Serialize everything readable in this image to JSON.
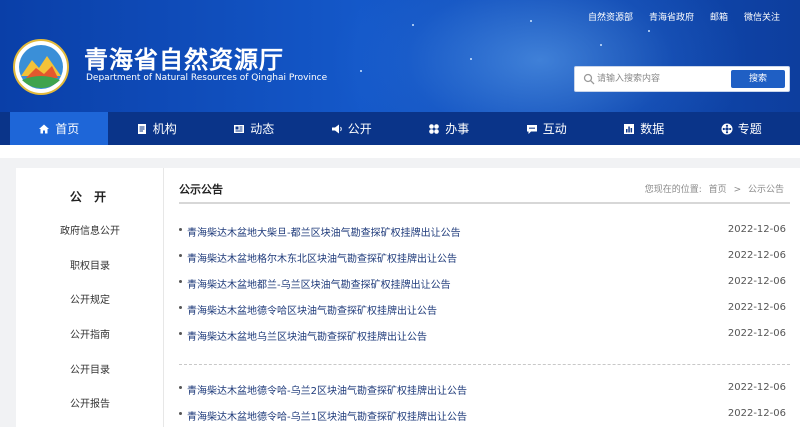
{
  "header": {
    "title": "青海省自然资源厅",
    "subtitle": "Department of Natural Resources of Qinghai Province",
    "top_links": [
      "自然资源部",
      "青海省政府",
      "邮箱",
      "微信关注"
    ],
    "search": {
      "placeholder": "请输入搜索内容",
      "button": "搜索"
    }
  },
  "nav": {
    "items": [
      {
        "label": "首页",
        "icon": "home-icon",
        "active": true
      },
      {
        "label": "机构",
        "icon": "document-icon"
      },
      {
        "label": "动态",
        "icon": "news-icon"
      },
      {
        "label": "公开",
        "icon": "megaphone-icon"
      },
      {
        "label": "办事",
        "icon": "grid-icon"
      },
      {
        "label": "互动",
        "icon": "chat-icon"
      },
      {
        "label": "数据",
        "icon": "chart-icon"
      },
      {
        "label": "专题",
        "icon": "flower-icon"
      }
    ]
  },
  "sidebar": {
    "title": "公 开",
    "items": [
      "政府信息公开",
      "职权目录",
      "公开规定",
      "公开指南",
      "公开目录",
      "公开报告"
    ]
  },
  "content": {
    "title": "公示公告",
    "breadcrumb": {
      "prefix": "您现在的位置:",
      "home": "首页",
      "sep": ">",
      "current": "公示公告"
    },
    "news": [
      {
        "title": "青海柴达木盆地大柴旦-都兰区块油气勘查探矿权挂牌出让公告",
        "date": "2022-12-06"
      },
      {
        "title": "青海柴达木盆地格尔木东北区块油气勘查探矿权挂牌出让公告",
        "date": "2022-12-06"
      },
      {
        "title": "青海柴达木盆地都兰-乌兰区块油气勘查探矿权挂牌出让公告",
        "date": "2022-12-06"
      },
      {
        "title": "青海柴达木盆地德令哈区块油气勘查探矿权挂牌出让公告",
        "date": "2022-12-06"
      },
      {
        "title": "青海柴达木盆地乌兰区块油气勘查探矿权挂牌出让公告",
        "date": "2022-12-06"
      },
      {
        "title": "青海柴达木盆地德令哈-乌兰2区块油气勘查探矿权挂牌出让公告",
        "date": "2022-12-06"
      },
      {
        "title": "青海柴达木盆地德令哈-乌兰1区块油气勘查探矿权挂牌出让公告",
        "date": "2022-12-06"
      }
    ]
  },
  "colors": {
    "header_blue": "#1458c9",
    "nav_blue": "#0a3489",
    "nav_active": "#1e66d8",
    "link_text": "#1e3a7a"
  }
}
